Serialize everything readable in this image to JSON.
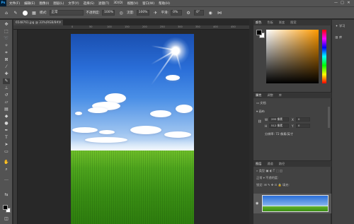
{
  "app": {
    "logo": "Ps"
  },
  "menu": [
    "文件(F)",
    "编辑(E)",
    "图像(I)",
    "图层(L)",
    "文字(Y)",
    "选择(S)",
    "滤镜(T)",
    "3D(D)",
    "视图(V)",
    "窗口(W)",
    "帮助(H)"
  ],
  "window_controls": {
    "minimize": "—",
    "maximize": "□",
    "close": "✕"
  },
  "options_bar": {
    "mode_label": "模式:",
    "mode_value": "正常",
    "opacity_label": "不透明度:",
    "opacity_value": "100%",
    "flow_label": "流量:",
    "flow_value": "100%",
    "smooth_label": "平滑:",
    "smooth_value": "0%",
    "angle_value": "0°"
  },
  "document": {
    "tab_title": "6548761.jpg @ 33%(RGB/8#)",
    "ruler_numbers": [
      "0",
      "50",
      "100",
      "150",
      "200",
      "250",
      "300",
      "350",
      "400",
      "450",
      "500",
      "550",
      "600",
      "650"
    ]
  },
  "panels": {
    "color_tabs": [
      "颜色",
      "色板",
      "渐变",
      "图案"
    ],
    "props_tabs": [
      "属性",
      "调整",
      "库"
    ],
    "props": {
      "doc_label": "文档",
      "canvas_label": "画布",
      "w_label": "W",
      "w_value": "295 像素",
      "h_label": "H",
      "h_value": "512 像素",
      "x_label": "X",
      "x_value": "0",
      "y_label": "Y",
      "y_value": "0",
      "resolution": "分辨率: 72 像素/英寸"
    },
    "layers_tabs": [
      "图层",
      "通道",
      "路径"
    ],
    "layers": {
      "search_label": "类型",
      "blend_mode": "正常",
      "opacity_label": "不透明度:",
      "lock_label": "锁定:",
      "fill_label": "填充:"
    }
  },
  "side_strip": {
    "learn": "学习",
    "libraries": "库"
  },
  "colors": {
    "accent": "#31a8ff",
    "chrome": "#535353",
    "panel": "#424242",
    "bg": "#282828"
  }
}
